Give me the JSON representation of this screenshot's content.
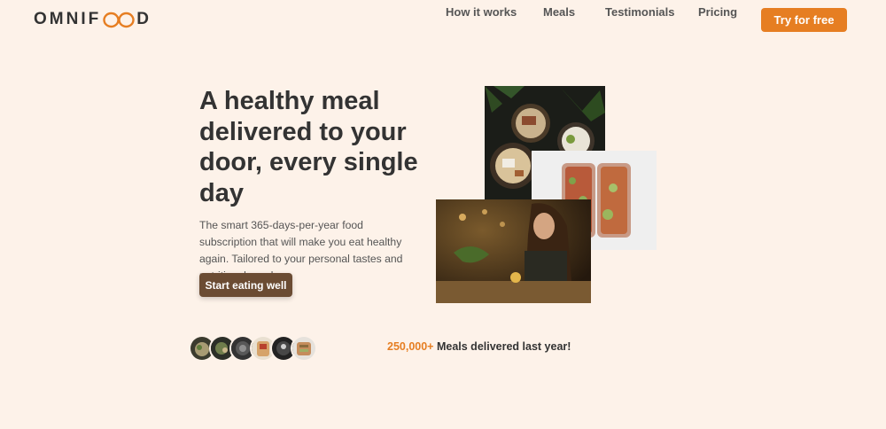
{
  "header": {
    "logo_left": "OMNIF",
    "logo_right": "D",
    "nav": [
      "How it works",
      "Meals",
      "Testimonials",
      "Pricing"
    ],
    "cta": "Try for free"
  },
  "hero": {
    "title": "A healthy meal delivered to your door, every single day",
    "description": "The smart 365-days-per-year food subscription that will make you eat healthy again. Tailored to your personal tastes and nutritional needs.",
    "button": "Start eating well"
  },
  "delivered": {
    "count": "250,000+",
    "text": "Meals delivered last year!"
  },
  "colors": {
    "accent": "#e67e22",
    "background": "#fdf2e9",
    "button_brown": "#6b4c33"
  }
}
